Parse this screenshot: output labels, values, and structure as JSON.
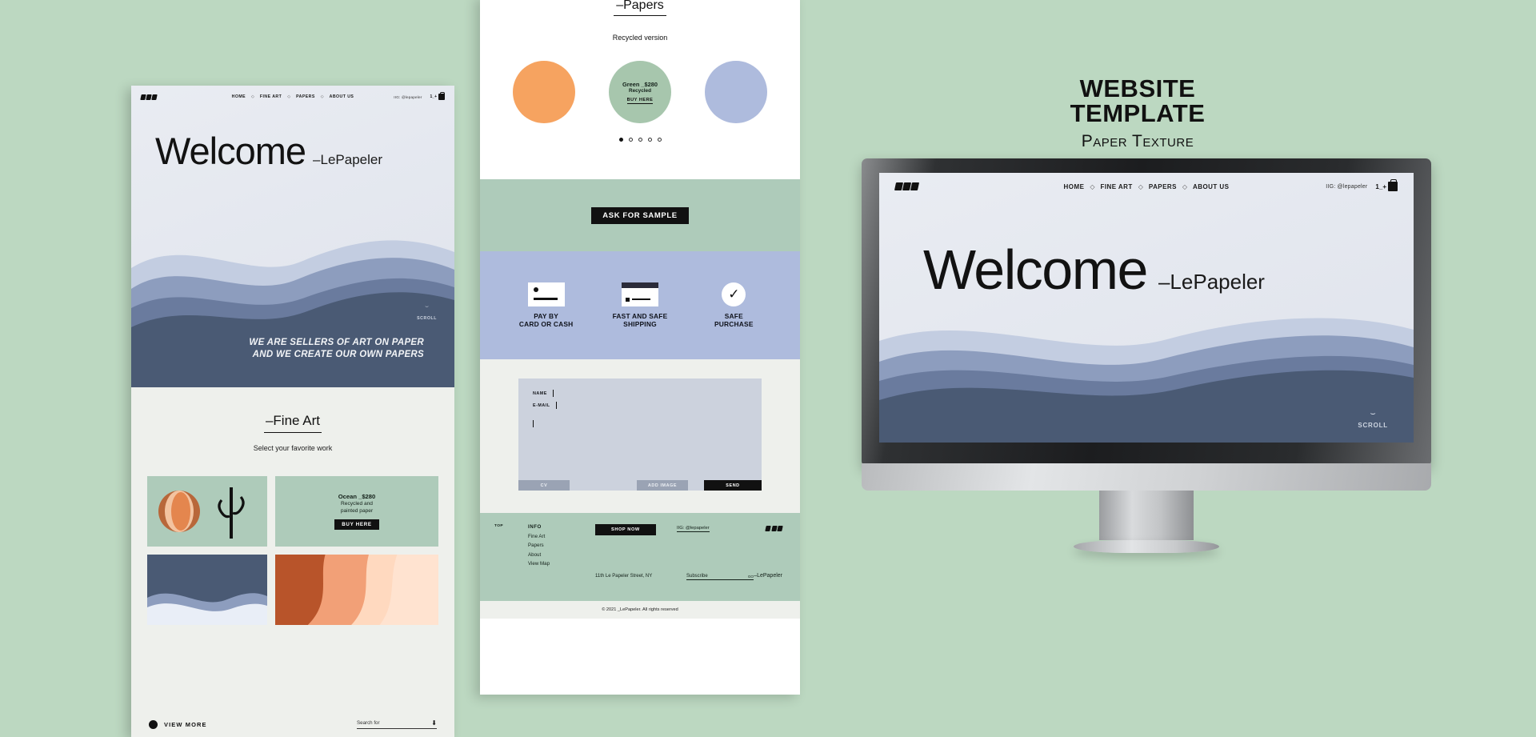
{
  "poster": {
    "background_color": "#bcd8c1",
    "title": "WEBSITE TEMPLATE",
    "subtitle": "Paper Texture"
  },
  "brand": {
    "name": "LePapeler",
    "hero_word": "Welcome",
    "hero_suffix": "–LePapeler",
    "logo_icon": "triple-diamond-logo-icon"
  },
  "nav": {
    "links": [
      "HOME",
      "FINE ART",
      "PAPERS",
      "ABOUT US"
    ],
    "separator_icon": "diamond-separator-icon",
    "instagram": "IIG: @lepapeler",
    "cart_label": "1_+",
    "cart_icon": "shopping-bag-icon"
  },
  "hero": {
    "tagline_line1": "WE ARE SELLERS OF ART ON PAPER",
    "tagline_line2": "AND WE CREATE OUR OWN PAPERS",
    "scroll_label": "SCROLL",
    "scroll_icon": "scroll-arc-icon",
    "wave_colors": [
      "#c3cde1",
      "#8d9dbe",
      "#6a7b9e",
      "#4a5a74"
    ],
    "sky_color": "#e9ecf2"
  },
  "fine_art": {
    "title": "–Fine Art",
    "subtitle": "Select your favorite work",
    "product": {
      "name": "Ocean _$280",
      "desc_line1": "Recycled and",
      "desc_line2": "painted paper",
      "buy_label": "BUY HERE"
    },
    "tiles": [
      "art-tile-cactus",
      "art-tile-ocean-card",
      "art-tile-navy-wave",
      "art-tile-rust-curve"
    ],
    "view_more": "VIEW MORE",
    "search_placeholder": "Search for",
    "search_icon": "download-arrow-icon"
  },
  "papers": {
    "title": "–Papers",
    "subtitle": "Recycled version",
    "swatches": [
      {
        "name": "",
        "price": "",
        "desc": "",
        "buy": "",
        "color": "#f6a360"
      },
      {
        "name": "Green _$280",
        "price": "",
        "desc": "Recycled",
        "buy": "BUY HERE",
        "color": "#a7c6ad"
      },
      {
        "name": "",
        "price": "",
        "desc": "",
        "buy": "",
        "color": "#aebbdd"
      }
    ],
    "carousel_dots": 5,
    "carousel_active": 1,
    "sample_button": "ASK FOR SAMPLE"
  },
  "features": [
    {
      "icon": "credit-card-icon",
      "line1": "PAY BY",
      "line2": "CARD OR CASH"
    },
    {
      "icon": "shipping-box-icon",
      "line1": "FAST AND SAFE",
      "line2": "SHIPPING"
    },
    {
      "icon": "check-circle-icon",
      "line1": "SAFE",
      "line2": "PURCHASE"
    }
  ],
  "contact_form": {
    "name_label": "NAME",
    "email_label": "E-MAIL",
    "cv_button": "CV",
    "add_image_button": "ADD IMAGE",
    "send_button": "SEND"
  },
  "footer": {
    "top_label": "TOP",
    "column": [
      "INFO",
      "Fine Art",
      "Papers",
      "About",
      "View Map"
    ],
    "shop_now": "SHOP NOW",
    "instagram": "IIG: @lepapeler",
    "address": "11th Le Papeler Street, NY",
    "subscribe_label": "Subscribe",
    "subscribe_go": "GO",
    "brand": "–LePapeler",
    "logo_icon": "triple-diamond-logo-icon",
    "copyright": "© 2021 _LePapeler. All rights reserved"
  }
}
